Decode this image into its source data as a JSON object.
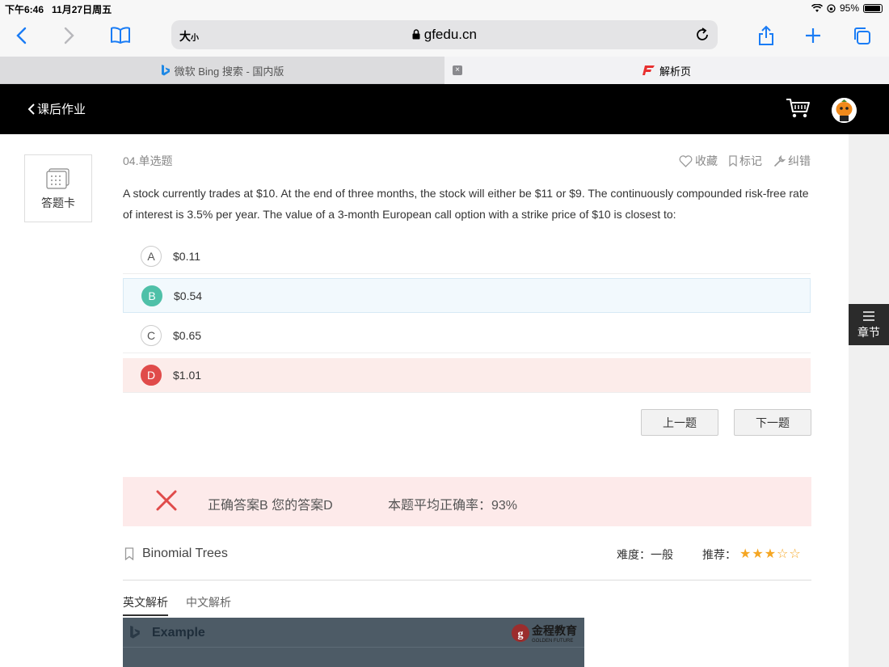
{
  "status_bar": {
    "time": "下午6:46",
    "date": "11月27日周五",
    "battery": "95%"
  },
  "browser": {
    "text_size_label": "大",
    "text_size_small": "小",
    "url": "gfedu.cn",
    "tabs": [
      {
        "label": "微软 Bing 搜索 - 国内版",
        "icon": "bing-icon",
        "active": false
      },
      {
        "label": "解析页",
        "icon": "gfedu-icon",
        "active": true
      }
    ]
  },
  "app_header": {
    "back_label": "课后作业"
  },
  "side": {
    "answer_card_label": "答题卡",
    "chapter_label": "章节"
  },
  "question": {
    "number_type": "04.单选题",
    "tools": [
      {
        "label": "收藏",
        "icon": "heart-icon"
      },
      {
        "label": "标记",
        "icon": "bookmark-icon"
      },
      {
        "label": "纠错",
        "icon": "wrench-icon"
      }
    ],
    "text": "A stock currently trades at $10. At the end of three months, the stock will either be $11 or $9. The continuously compounded risk-free rate of interest is 3.5% per year. The value of a 3-month European call option with a strike price of $10 is closest to:",
    "options": [
      {
        "letter": "A",
        "text": "$0.11",
        "state": "normal"
      },
      {
        "letter": "B",
        "text": "$0.54",
        "state": "correct"
      },
      {
        "letter": "C",
        "text": "$0.65",
        "state": "normal"
      },
      {
        "letter": "D",
        "text": "$1.01",
        "state": "wrong"
      }
    ],
    "prev_label": "上一题",
    "next_label": "下一题"
  },
  "result": {
    "answer_text": "正确答案B 您的答案D",
    "avg_rate_text": "本题平均正确率：93%"
  },
  "topic": {
    "name": "Binomial Trees",
    "difficulty_label": "难度：一般",
    "recommend_label": "推荐：",
    "stars": 3,
    "stars_max": 5
  },
  "analysis_tabs": [
    {
      "label": "英文解析",
      "active": true
    },
    {
      "label": "中文解析",
      "active": false
    }
  ],
  "example": {
    "title": "Example",
    "logo_text": "金程教育",
    "logo_sub": "GOLDEN FUTURE"
  }
}
